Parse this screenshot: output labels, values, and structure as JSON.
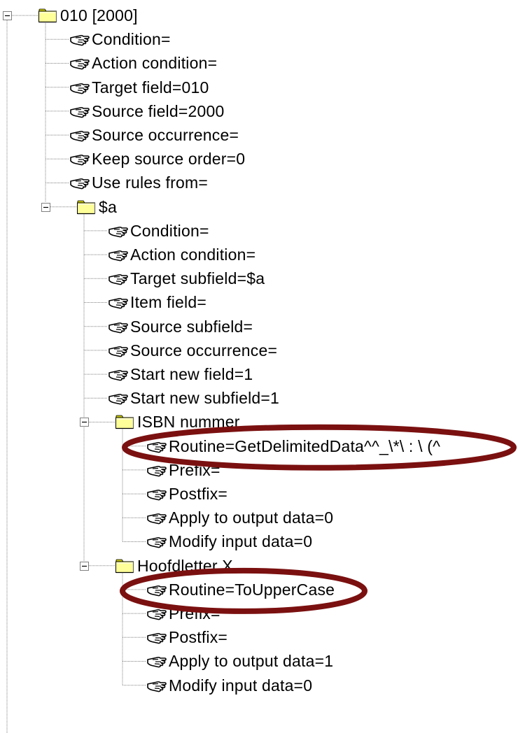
{
  "tree": {
    "root": {
      "label": "010 [2000]",
      "expanded": true,
      "properties": [
        "Condition=",
        "Action condition=",
        "Target field=010",
        "Source field=2000",
        "Source occurrence=",
        "Keep source order=0",
        "Use rules from="
      ],
      "subfield": {
        "label": "$a",
        "expanded": true,
        "properties": [
          "Condition=",
          "Action condition=",
          "Target subfield=$a",
          "Item field=",
          "Source subfield=",
          "Source occurrence=",
          "Start new field=1",
          "Start new subfield=1"
        ],
        "rules": [
          {
            "label": "ISBN nummer",
            "expanded": true,
            "properties": [
              "Routine=GetDelimitedData^^_\\*\\ : \\ (^",
              "Prefix=",
              "Postfix=",
              "Apply to output data=0",
              "Modify input data=0"
            ]
          },
          {
            "label": "Hoofdletter X",
            "expanded": true,
            "properties": [
              "Routine=ToUpperCase",
              "Prefix=",
              "Postfix=",
              "Apply to output data=1",
              "Modify input data=0"
            ]
          }
        ]
      }
    }
  },
  "icons": {
    "folder": "folder-icon",
    "property": "hand-pointer-icon",
    "toggle": "collapse-minus-icon"
  },
  "colors": {
    "folder_fill": "#ffff99",
    "folder_shade": "#c8c800",
    "highlight_ellipse": "#7b1010",
    "tree_lines": "#808080"
  }
}
